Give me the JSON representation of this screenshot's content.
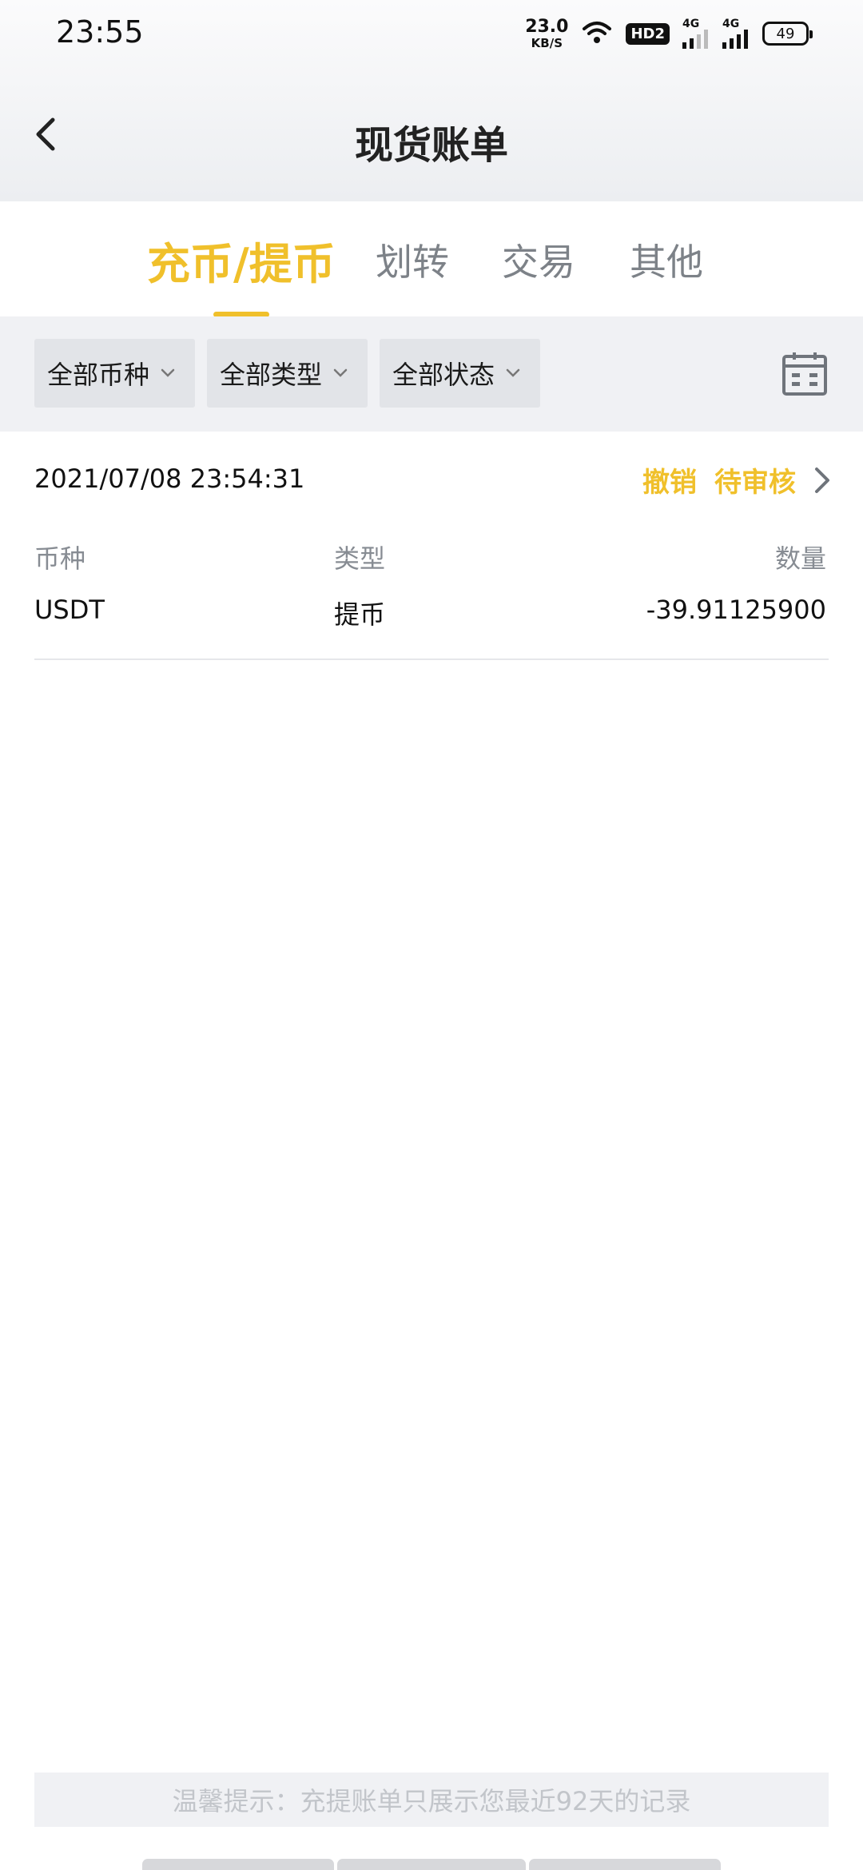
{
  "status_bar": {
    "time": "23:55",
    "net_speed_value": "23.0",
    "net_speed_unit": "KB/S",
    "hd_label": "HD2",
    "signal1_label": "4G",
    "signal2_label": "4G",
    "battery_level": "49",
    "icons": [
      "wifi-icon",
      "signal-icon",
      "signal-icon",
      "battery-icon"
    ]
  },
  "header": {
    "title": "现货账单",
    "back_icon": "chevron-left-icon"
  },
  "tabs": [
    {
      "label": "充币/提币",
      "active": true
    },
    {
      "label": "划转",
      "active": false
    },
    {
      "label": "交易",
      "active": false
    },
    {
      "label": "其他",
      "active": false
    }
  ],
  "filters": [
    {
      "label": "全部币种"
    },
    {
      "label": "全部类型"
    },
    {
      "label": "全部状态"
    }
  ],
  "calendar_icon": "calendar-icon",
  "record": {
    "timestamp": "2021/07/08 23:54:31",
    "cancel_label": "撤销",
    "status_label": "待审核",
    "headers": {
      "coin": "币种",
      "type": "类型",
      "amount": "数量"
    },
    "values": {
      "coin": "USDT",
      "type": "提币",
      "amount": "-39.91125900"
    }
  },
  "footer": {
    "tip": "温馨提示：充提账单只展示您最近92天的记录"
  },
  "colors": {
    "accent": "#f0c02b",
    "muted_text": "#878c93",
    "filter_bg": "#e2e4e8"
  }
}
